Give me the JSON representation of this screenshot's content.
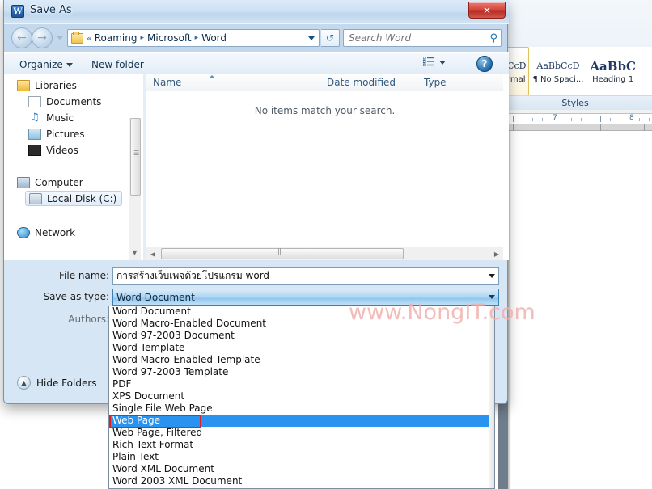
{
  "word_app": {
    "styles_group_label": "Styles",
    "style_gallery": [
      {
        "preview": "bCcD",
        "label": "ormal",
        "selected": true
      },
      {
        "preview": "AaBbCcD",
        "label": "¶ No Spaci...",
        "selected": false
      },
      {
        "preview": "AaBbC",
        "label": "Heading 1",
        "selected": false
      }
    ],
    "ruler_marks": [
      "7",
      "8"
    ]
  },
  "dialog": {
    "title": "Save As",
    "title_icon": "word-icon",
    "close_label": "✕",
    "navigation": {
      "back_icon": "←",
      "forward_icon": "→",
      "recent_pages_icon": "chevron-down-icon",
      "breadcrumb_chevron": "«",
      "breadcrumbs": [
        "Roaming",
        "Microsoft",
        "Word"
      ],
      "breadcrumb_separator": "▸",
      "refresh_icon": "↺",
      "search_placeholder": "Search Word",
      "search_value": "",
      "search_icon": "⚲"
    },
    "toolbar": {
      "organize_label": "Organize",
      "new_folder_label": "New folder",
      "view_icon": "list-view-icon",
      "help_label": "?"
    },
    "nav_pane": {
      "items": [
        {
          "label": "Libraries",
          "icon": "library-icon",
          "indent": 8,
          "selected": false
        },
        {
          "label": "Documents",
          "icon": "documents-icon",
          "indent": 22,
          "selected": false
        },
        {
          "label": "Music",
          "icon": "music-icon",
          "indent": 22,
          "selected": false
        },
        {
          "label": "Pictures",
          "icon": "pictures-icon",
          "indent": 22,
          "selected": false
        },
        {
          "label": "Videos",
          "icon": "videos-icon",
          "indent": 22,
          "selected": false
        },
        {
          "label": "Computer",
          "icon": "computer-icon",
          "indent": 8,
          "selected": false
        },
        {
          "label": "Local Disk (C:)",
          "icon": "disk-icon",
          "indent": 22,
          "selected": true
        },
        {
          "label": "Network",
          "icon": "network-icon",
          "indent": 8,
          "selected": false
        }
      ]
    },
    "file_list": {
      "columns": [
        "Name",
        "Date modified",
        "Type"
      ],
      "sorted_column": "Name",
      "empty_message": "No items match your search.",
      "rows": []
    },
    "form": {
      "filename_label": "File name:",
      "filename_value": "การสร้างเว็บเพจด้วยโปรแกรม word",
      "savetype_label": "Save as type:",
      "savetype_value": "Word Document",
      "authors_label": "Authors:",
      "authors_value": "",
      "hide_folders_label": "Hide Folders"
    },
    "savetype_dropdown": {
      "open": true,
      "selected": "Web Page",
      "highlight_color": "#e02020",
      "selection_color": "#2a92ef",
      "options": [
        "Word Document",
        "Word Macro-Enabled Document",
        "Word 97-2003 Document",
        "Word Template",
        "Word Macro-Enabled Template",
        "Word 97-2003 Template",
        "PDF",
        "XPS Document",
        "Single File Web Page",
        "Web Page",
        "Web Page, Filtered",
        "Rich Text Format",
        "Plain Text",
        "Word XML Document",
        "Word 2003 XML Document"
      ]
    }
  },
  "watermark": {
    "text": "www.NongIT.com",
    "color": "#f0b1ae"
  }
}
